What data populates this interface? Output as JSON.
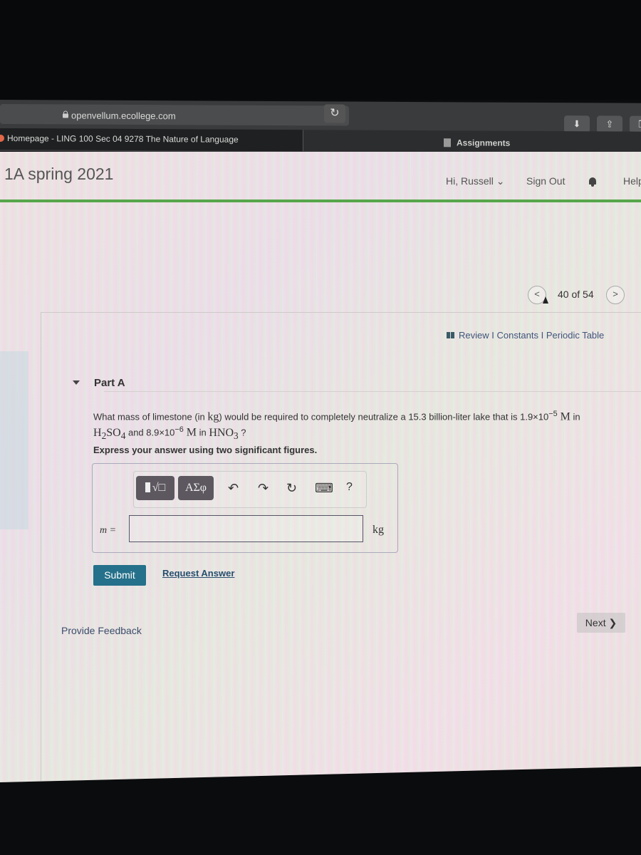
{
  "browser": {
    "url": "openvellum.ecollege.com",
    "tab_title": "Homepage - LING 100 Sec 04 9278 The Nature of Language",
    "bookmark": "Assignments",
    "reload_glyph": "↻",
    "download_glyph": "⬇",
    "share_glyph": "⇪",
    "tabs_glyph": "❐"
  },
  "header": {
    "course_title": "1A spring 2021",
    "user_menu": "Hi, Russell ⌄",
    "sign_out": "Sign Out",
    "help": "Help",
    "accent_color": "#57a64a"
  },
  "navigation": {
    "prev_glyph": "<",
    "next_glyph": ">",
    "position": "40 of 54",
    "current": 40,
    "total": 54
  },
  "resources": {
    "review": "Review",
    "constants": "Constants",
    "periodic_table": "Periodic Table",
    "separator": " I "
  },
  "part": {
    "title": "Part A",
    "question_pre": "What mass of limestone (in ",
    "question_unit": "kg",
    "question_mid": ") would be required to completely neutralize a 15.3 billion-liter lake that is 1.9×10",
    "exp1": "−5",
    "molar": " M",
    "question_in": " in",
    "h2so4_h": "H",
    "h2so4_2": "2",
    "h2so4_so": "SO",
    "h2so4_4": "4",
    "and_text": " and 8.9×10",
    "exp2": "−6",
    "in_hno3": " in ",
    "hno3": "HNO",
    "hno3_3": "3",
    "q_mark": " ?",
    "instruction": "Express your answer using two significant figures."
  },
  "answer": {
    "templates_label": "√□",
    "greek_label": "ΑΣφ",
    "undo_glyph": "↶",
    "redo_glyph": "↷",
    "reset_glyph": "↻",
    "keyboard_glyph": "⌨",
    "help_glyph": "?",
    "variable": "m =",
    "value": "",
    "unit": "kg"
  },
  "actions": {
    "submit": "Submit",
    "request_answer": "Request Answer",
    "provide_feedback": "Provide Feedback",
    "next": "Next ❯",
    "submit_color": "#25708a"
  }
}
